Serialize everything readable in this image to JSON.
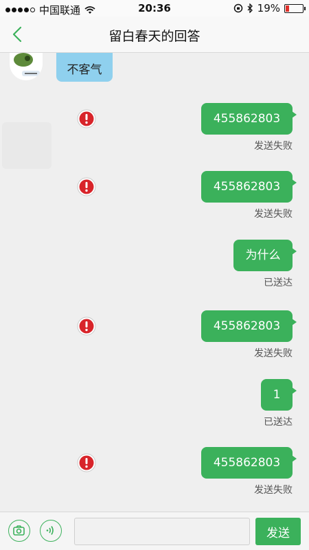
{
  "status_bar": {
    "carrier": "中国联通",
    "time": "20:36",
    "battery": "19%",
    "battery_level": 0.19
  },
  "nav": {
    "title": "留白春天的回答",
    "back_icon": "chevron-left-icon"
  },
  "incoming": {
    "text": "不客气"
  },
  "messages": [
    {
      "text": "455862803",
      "status": "发送失败",
      "failed": true
    },
    {
      "text": "455862803",
      "status": "发送失败",
      "failed": true
    },
    {
      "text": "为什么",
      "status": "已送达",
      "failed": false
    },
    {
      "text": "455862803",
      "status": "发送失败",
      "failed": true
    },
    {
      "text": "1",
      "status": "已送达",
      "failed": false
    },
    {
      "text": "455862803",
      "status": "发送失败",
      "failed": true
    }
  ],
  "input_bar": {
    "camera_icon": "camera-icon",
    "voice_icon": "voice-icon",
    "input_value": "",
    "send_label": "发送"
  },
  "colors": {
    "accent_green": "#3bb15b",
    "incoming_blue": "#8fd0ee",
    "error_red": "#d8242a"
  }
}
